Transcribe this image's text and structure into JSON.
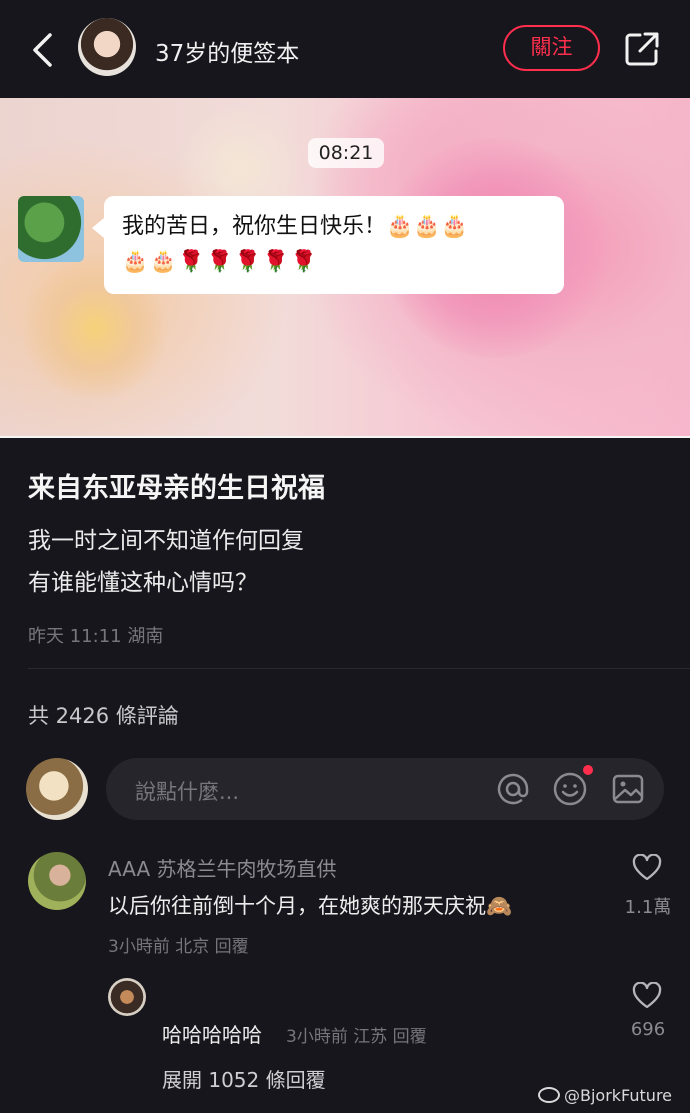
{
  "header": {
    "author_name": "37岁的便签本",
    "follow_label": "關注"
  },
  "chat_image": {
    "time": "08:21",
    "message_text": "我的苦日，祝你生日快乐！🎂🎂🎂",
    "message_emojis": "🎂🎂🌹🌹🌹🌹🌹"
  },
  "post": {
    "title": "来自东亚母亲的生日祝福",
    "body_line1": "我一时之间不知道作何回复",
    "body_line2": "有谁能懂这种心情吗？",
    "meta": "昨天 11:11 湖南"
  },
  "comments_section": {
    "count_label": "共 2426 條評論",
    "input_placeholder": "說點什麼..."
  },
  "comments": [
    {
      "author": "AAA 苏格兰牛肉牧场直供",
      "text": "以后你往前倒十个月，在她爽的那天庆祝🙈",
      "meta": "3小時前 北京 回覆",
      "likes": "1.1萬"
    },
    {
      "author": "哈哈哈哈哈",
      "meta": "3小時前 江苏 回覆",
      "likes": "696"
    }
  ],
  "expand_label": "展開 1052 條回覆",
  "watermark": "@BjorkFuture",
  "colors": {
    "accent": "#ff2e4d",
    "background": "#17161c"
  },
  "icons": [
    "back-icon",
    "share-icon",
    "voice-icon",
    "smile-icon",
    "plus-icon",
    "at-icon",
    "emoji-icon",
    "image-icon",
    "heart-icon",
    "weibo-icon"
  ]
}
